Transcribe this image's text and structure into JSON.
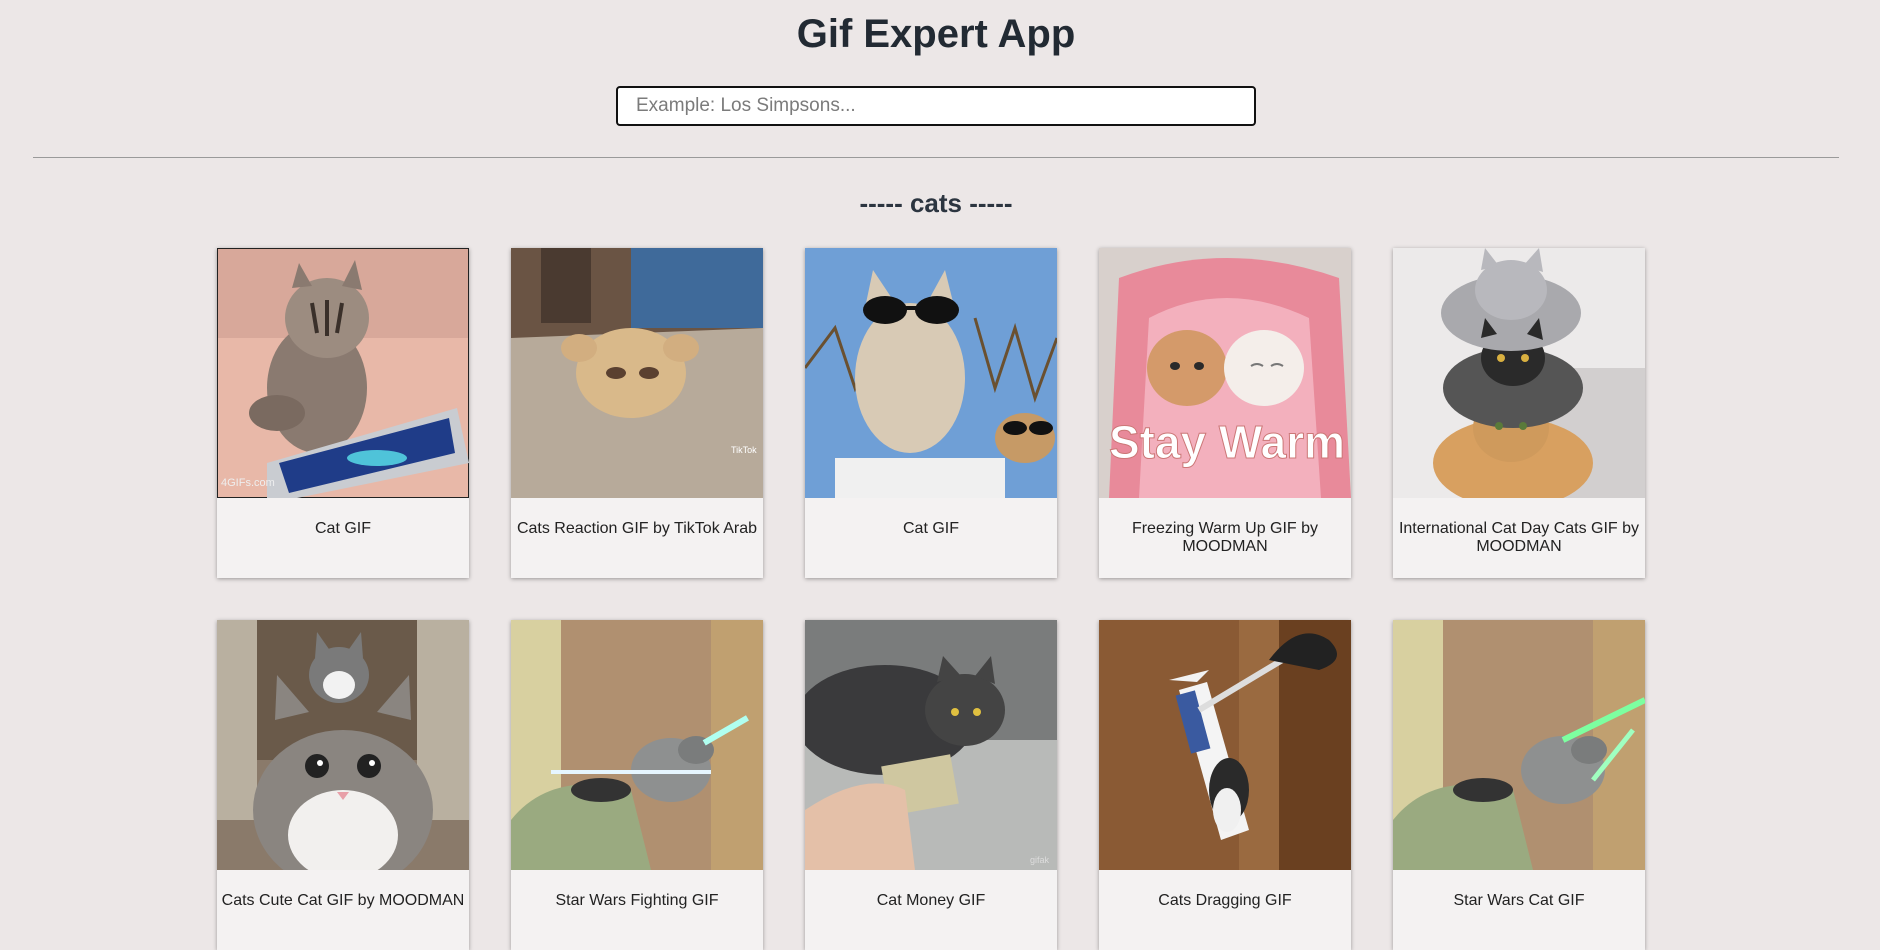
{
  "header": {
    "title": "Gif Expert App"
  },
  "search": {
    "placeholder": "Example: Los Simpsons...",
    "value": ""
  },
  "category": {
    "title": "----- cats -----",
    "gifs": [
      {
        "caption": "Cat GIF",
        "icon": "cat-kitten-phone-image"
      },
      {
        "caption": "Cats Reaction GIF by TikTok Arab",
        "icon": "cat-fluffy-face-image"
      },
      {
        "caption": "Cat GIF",
        "icon": "cat-sunglasses-image"
      },
      {
        "caption": "Freezing Warm Up GIF by MOODMAN",
        "icon": "cats-stay-warm-image"
      },
      {
        "caption": "International Cat Day Cats GIF by MOODMAN",
        "icon": "cats-stacked-image"
      },
      {
        "caption": "Cats Cute Cat GIF by MOODMAN",
        "icon": "cats-cute-image"
      },
      {
        "caption": "Star Wars Fighting GIF",
        "icon": "cat-lightsaber-image"
      },
      {
        "caption": "Cat Money GIF",
        "icon": "cat-money-image"
      },
      {
        "caption": "Cats Dragging GIF",
        "icon": "cat-dragging-image"
      },
      {
        "caption": "Star Wars Cat GIF",
        "icon": "cat-lightsaber-green-image"
      }
    ]
  },
  "image_labels": {
    "watermark_4gifs": "4GIFs.com",
    "watermark_tiktok": "TikTok",
    "stay_warm_text": "Stay Warm",
    "watermark_gifak": "gifak"
  }
}
